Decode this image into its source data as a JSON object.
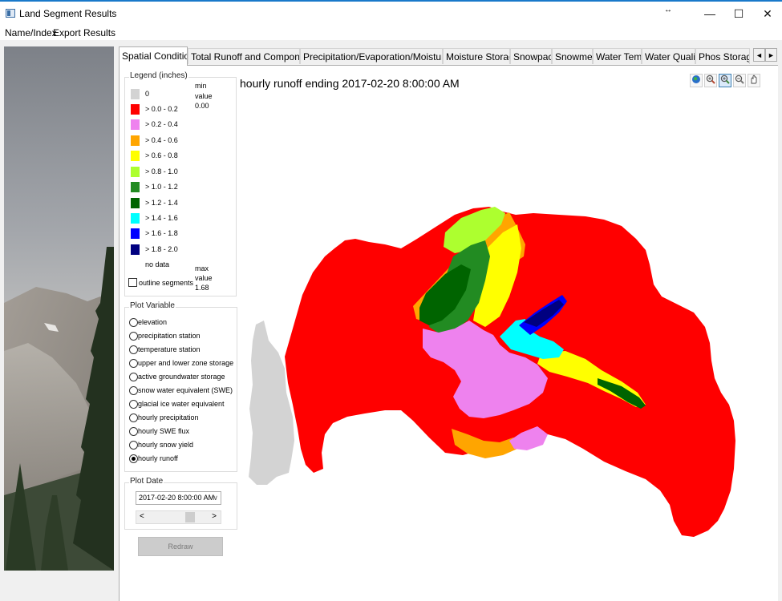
{
  "window": {
    "title": "Land Segment Results",
    "minimize": "—",
    "maximize": "☐",
    "close": "✕",
    "resize": "↔"
  },
  "menu": [
    "Name/Index",
    "Export Results"
  ],
  "tabs": [
    "Spatial Conditions",
    "Total Runoff and Components",
    "Precipitation/Evaporation/Moisture Flux",
    "Moisture Storage",
    "Snowpack",
    "Snowmelt",
    "Water Temp",
    "Water Quality",
    "Phos Storage"
  ],
  "tab_scroll": {
    "left": "◄",
    "right": "►"
  },
  "legend": {
    "title": "Legend (inches)",
    "items": [
      {
        "label": "0",
        "color": "#d3d3d3"
      },
      {
        "label": "> 0.0 - 0.2",
        "color": "#ff0000"
      },
      {
        "label": "> 0.2 - 0.4",
        "color": "#ee82ee"
      },
      {
        "label": "> 0.4 - 0.6",
        "color": "#ffa500"
      },
      {
        "label": "> 0.6 - 0.8",
        "color": "#ffff00"
      },
      {
        "label": "> 0.8 - 1.0",
        "color": "#adff2f"
      },
      {
        "label": "> 1.0 - 1.2",
        "color": "#228b22"
      },
      {
        "label": "> 1.2 - 1.4",
        "color": "#006400"
      },
      {
        "label": "> 1.4 - 1.6",
        "color": "#00ffff"
      },
      {
        "label": "> 1.6 - 1.8",
        "color": "#0000ff"
      },
      {
        "label": "> 1.8 - 2.0",
        "color": "#000080"
      },
      {
        "label": "no data",
        "color": ""
      }
    ],
    "min_label": "min",
    "min_label2": "value",
    "min_value": "0.00",
    "max_label": "max",
    "max_label2": "value",
    "max_value": "1.68",
    "outline_label": "outline segments"
  },
  "plot_variable": {
    "title": "Plot Variable",
    "options": [
      "elevation",
      "precipitation station",
      "temperature station",
      "upper and lower zone storage",
      "active groundwater storage",
      "snow water equivalent (SWE)",
      "glacial ice water equivalent",
      "hourly precipitation",
      "hourly SWE flux",
      "hourly snow yield",
      "hourly runoff"
    ],
    "selected": "hourly runoff"
  },
  "plot_date": {
    "title": "Plot Date",
    "value": "2017-02-20 8:00:00 AM",
    "scroll_left": "<",
    "scroll_right": ">"
  },
  "redraw_label": "Redraw",
  "map": {
    "title": "hourly runoff ending 2017-02-20 8:00:00 AM"
  },
  "map_tools": [
    "globe-icon",
    "zoom-in-icon",
    "zoom-in-active-icon",
    "zoom-out-icon",
    "pan-hand-icon"
  ]
}
